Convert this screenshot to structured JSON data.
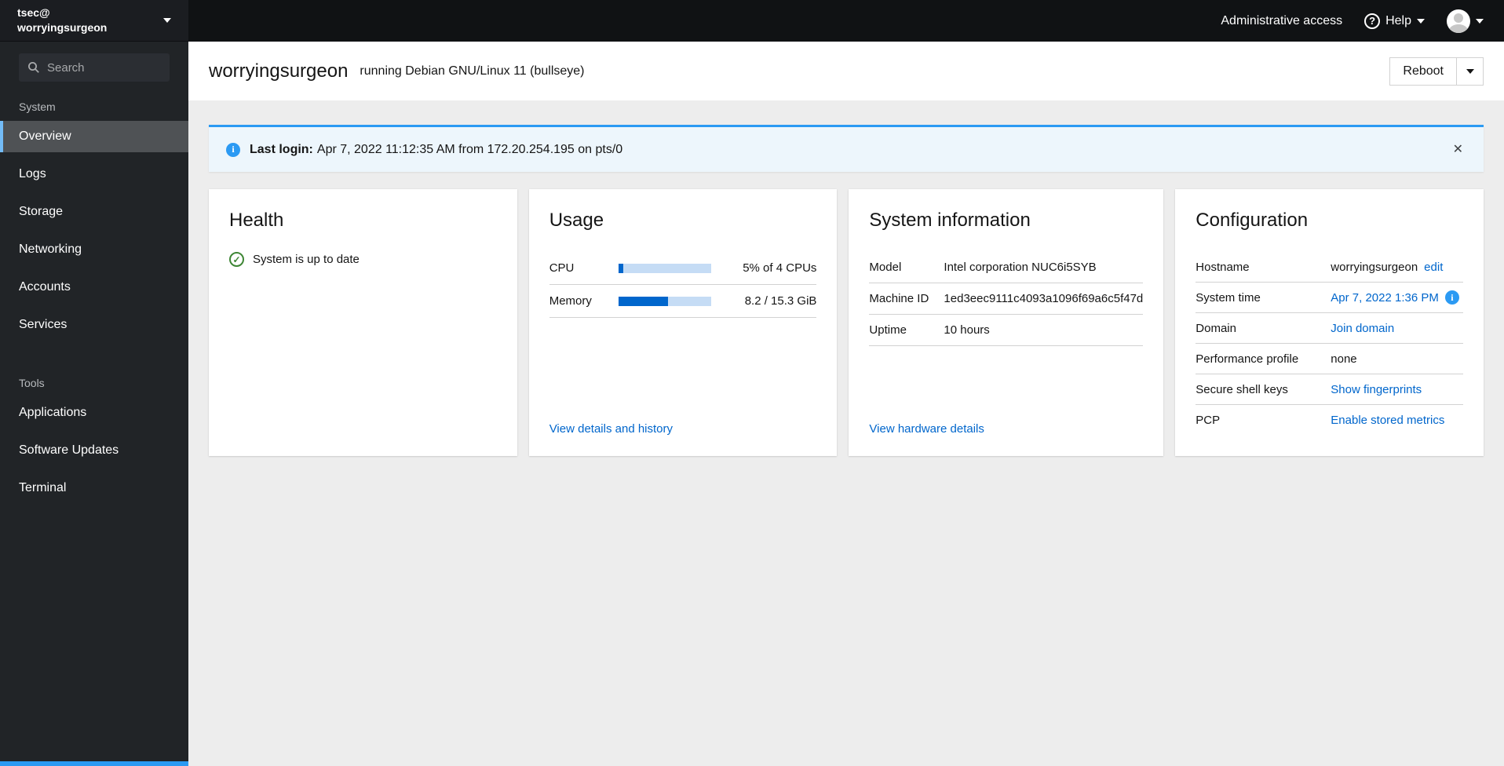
{
  "masthead": {
    "admin_access_label": "Administrative access",
    "help_label": "Help"
  },
  "sidebar": {
    "user_line1": "tsec@",
    "user_line2": "worryingsurgeon",
    "search_placeholder": "Search",
    "sections": [
      {
        "label": "System",
        "items": [
          "Overview",
          "Logs",
          "Storage",
          "Networking",
          "Accounts",
          "Services"
        ]
      },
      {
        "label": "Tools",
        "items": [
          "Applications",
          "Software Updates",
          "Terminal"
        ]
      }
    ],
    "active_item": "Overview"
  },
  "header": {
    "hostname": "worryingsurgeon",
    "subtitle": "running Debian GNU/Linux 11 (bullseye)",
    "reboot_label": "Reboot"
  },
  "alert": {
    "title": "Last login:",
    "message": "Apr 7, 2022 11:12:35 AM from 172.20.254.195 on pts/0",
    "close_glyph": "✕"
  },
  "cards": {
    "health": {
      "title": "Health",
      "status": "System is up to date"
    },
    "usage": {
      "title": "Usage",
      "rows": [
        {
          "label": "CPU",
          "percent": 5,
          "value": "5% of 4 CPUs"
        },
        {
          "label": "Memory",
          "percent": 54,
          "value": "8.2 / 15.3 GiB"
        }
      ],
      "link": "View details and history"
    },
    "system_info": {
      "title": "System information",
      "rows": [
        {
          "label": "Model",
          "value": "Intel corporation NUC6i5SYB"
        },
        {
          "label": "Machine ID",
          "value": "1ed3eec9111c4093a1096f69a6c5f47d"
        },
        {
          "label": "Uptime",
          "value": "10 hours"
        }
      ],
      "link": "View hardware details"
    },
    "configuration": {
      "title": "Configuration",
      "rows": [
        {
          "label": "Hostname",
          "value": "worryingsurgeon",
          "link": "edit"
        },
        {
          "label": "System time",
          "link": "Apr 7, 2022 1:36 PM"
        },
        {
          "label": "Domain",
          "link": "Join domain"
        },
        {
          "label": "Performance profile",
          "value": "none"
        },
        {
          "label": "Secure shell keys",
          "link": "Show fingerprints"
        },
        {
          "label": "PCP",
          "link": "Enable stored metrics"
        }
      ]
    }
  },
  "colors": {
    "link_blue": "#0066cc",
    "alert_blue": "#2b9af3",
    "success_green": "#3e8635",
    "active_nav_border": "#73bcf7",
    "progress_fill": "#0066cc",
    "progress_track": "#c5dcf5",
    "sidebar_bg": "#212427",
    "masthead_bg": "#101214"
  }
}
